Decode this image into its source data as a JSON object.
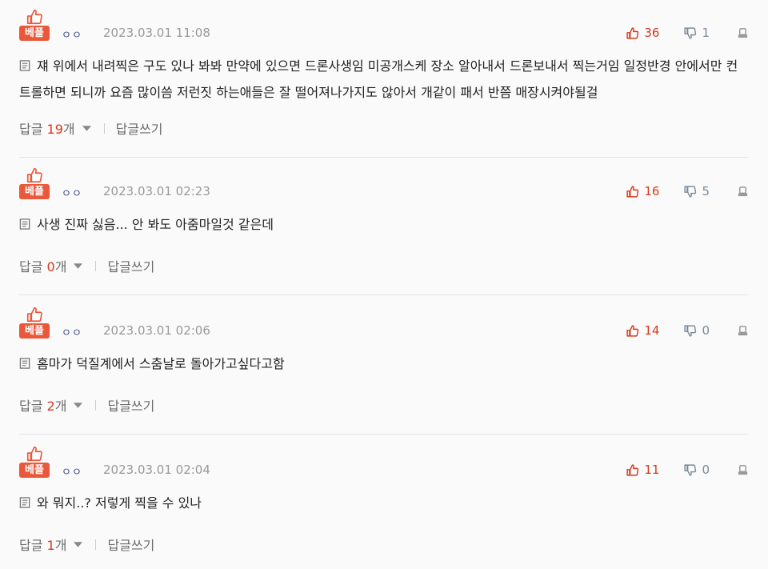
{
  "comments": [
    {
      "badge": "베플",
      "nickname": "ㅇㅇ",
      "date": "2023.03.01 11:08",
      "up": "36",
      "down": "1",
      "text": "쟤 위에서 내려찍은 구도 있나 봐봐 만약에 있으면 드론사생임 미공개스케 장소 알아내서 드론보내서 찍는거임 일정반경 안에서만 컨트롤하면 되니까 요즘 많이씀 저런짓 하는애들은 잘 떨어져나가지도 않아서 개같이 패서 반쯤 매장시켜야될걸",
      "reply_label": "답글",
      "reply_count": "19",
      "reply_unit": "개",
      "write_reply": "답글쓰기"
    },
    {
      "badge": "베플",
      "nickname": "ㅇㅇ",
      "date": "2023.03.01 02:23",
      "up": "16",
      "down": "5",
      "text": "사생 진짜 싫음... 안 봐도 아줌마일것 같은데",
      "reply_label": "답글",
      "reply_count": "0",
      "reply_unit": "개",
      "write_reply": "답글쓰기"
    },
    {
      "badge": "베플",
      "nickname": "ㅇㅇ",
      "date": "2023.03.01 02:06",
      "up": "14",
      "down": "0",
      "text": "홈마가 덕질계에서 스춤날로 돌아가고싶다고함",
      "reply_label": "답글",
      "reply_count": "2",
      "reply_unit": "개",
      "write_reply": "답글쓰기"
    },
    {
      "badge": "베플",
      "nickname": "ㅇㅇ",
      "date": "2023.03.01 02:04",
      "up": "11",
      "down": "0",
      "text": "와 뭐지..? 저렇게 찍을 수 있나",
      "reply_label": "답글",
      "reply_count": "1",
      "reply_unit": "개",
      "write_reply": "답글쓰기"
    }
  ],
  "colors": {
    "badge": "#e9583b",
    "upvote": "#d6391c",
    "downvote": "#7b8a99",
    "nickname": "#3b4a86",
    "date": "#999999"
  },
  "icons": {
    "badge": "thumbs-up-icon",
    "up": "thumbs-up-icon",
    "down": "thumbs-down-icon",
    "report": "report-icon",
    "memo": "memo-icon",
    "caret": "caret-down-icon"
  }
}
